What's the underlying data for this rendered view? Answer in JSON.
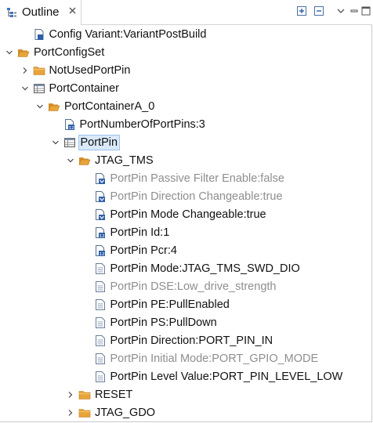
{
  "view": {
    "title": "Outline",
    "toolbar": {
      "expand_all": "expand-all-icon",
      "collapse_all": "collapse-all-icon",
      "view_menu": "view-menu-icon",
      "minimize": "minimize-icon",
      "maximize": "maximize-icon"
    }
  },
  "colors": {
    "folder": "#e8a33a",
    "selection_bg": "#d9e9f9",
    "selection_border": "#9cc3ea",
    "dim_text": "#8e8e8e"
  },
  "tree": [
    {
      "label": "Config Variant:VariantPostBuild",
      "icon": "parameter-icon",
      "twisty": "none",
      "depth": 1
    },
    {
      "label": "PortConfigSet",
      "icon": "folder-open-icon",
      "twisty": "expanded",
      "depth": 0
    },
    {
      "label": "NotUsedPortPin",
      "icon": "folder-closed-icon",
      "twisty": "collapsed",
      "depth": 1
    },
    {
      "label": "PortContainer",
      "icon": "table-icon",
      "twisty": "expanded",
      "depth": 1
    },
    {
      "label": "PortContainerA_0",
      "icon": "folder-open-icon",
      "twisty": "expanded",
      "depth": 2
    },
    {
      "label": "PortNumberOfPortPins:3",
      "icon": "integer-param-icon",
      "twisty": "none",
      "depth": 3
    },
    {
      "label": "PortPin",
      "icon": "table-icon",
      "twisty": "expanded",
      "depth": 3,
      "selected": true
    },
    {
      "label": "JTAG_TMS",
      "icon": "folder-open-icon",
      "twisty": "expanded",
      "depth": 4
    },
    {
      "label": "PortPin Passive Filter Enable:false",
      "icon": "boolean-param-icon",
      "twisty": "none",
      "depth": 5,
      "dim": true
    },
    {
      "label": "PortPin Direction Changeable:true",
      "icon": "boolean-param-icon",
      "twisty": "none",
      "depth": 5,
      "dim": true
    },
    {
      "label": "PortPin Mode Changeable:true",
      "icon": "boolean-param-icon",
      "twisty": "none",
      "depth": 5
    },
    {
      "label": "PortPin Id:1",
      "icon": "integer-param-icon",
      "twisty": "none",
      "depth": 5
    },
    {
      "label": "PortPin Pcr:4",
      "icon": "integer-param-icon",
      "twisty": "none",
      "depth": 5
    },
    {
      "label": "PortPin Mode:JTAG_TMS_SWD_DIO",
      "icon": "enum-param-icon",
      "twisty": "none",
      "depth": 5
    },
    {
      "label": "PortPin DSE:Low_drive_strength",
      "icon": "enum-param-icon",
      "twisty": "none",
      "depth": 5,
      "dim": true
    },
    {
      "label": "PortPin PE:PullEnabled",
      "icon": "enum-param-icon",
      "twisty": "none",
      "depth": 5
    },
    {
      "label": "PortPin PS:PullDown",
      "icon": "enum-param-icon",
      "twisty": "none",
      "depth": 5
    },
    {
      "label": "PortPin Direction:PORT_PIN_IN",
      "icon": "enum-param-icon",
      "twisty": "none",
      "depth": 5
    },
    {
      "label": "PortPin Initial Mode:PORT_GPIO_MODE",
      "icon": "enum-param-icon",
      "twisty": "none",
      "depth": 5,
      "dim": true
    },
    {
      "label": "PortPin Level Value:PORT_PIN_LEVEL_LOW",
      "icon": "enum-param-icon",
      "twisty": "none",
      "depth": 5
    },
    {
      "label": "RESET",
      "icon": "folder-closed-icon",
      "twisty": "collapsed",
      "depth": 4
    },
    {
      "label": "JTAG_GDO",
      "icon": "folder-closed-icon",
      "twisty": "collapsed",
      "depth": 4
    }
  ]
}
